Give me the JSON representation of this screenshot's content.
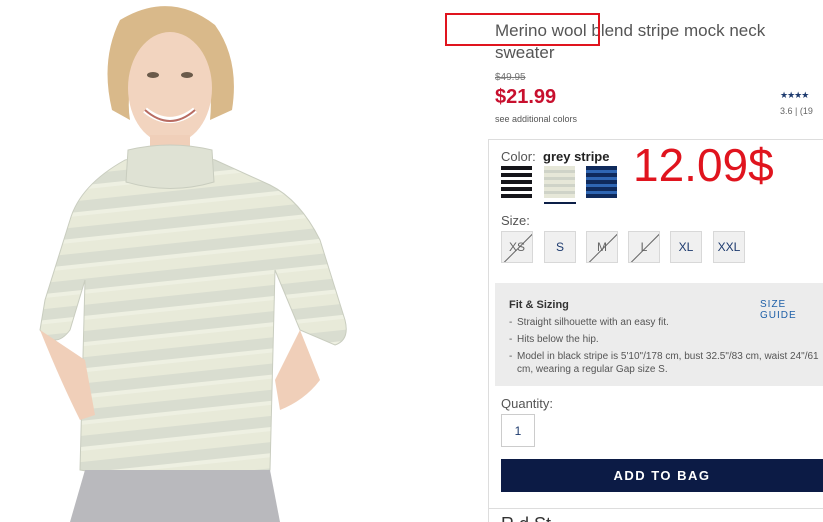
{
  "product": {
    "title": "Merino wool blend stripe mock neck sweater",
    "original_price": "$49.95",
    "sale_price": "$21.99",
    "see_colors_link": "see additional colors",
    "rating": {
      "stars": "★★★★",
      "text": "3.6 | (19"
    }
  },
  "annotation": {
    "price_note": "12.09$",
    "color": "#e0141e"
  },
  "color_picker": {
    "label": "Color:",
    "selected": "grey stripe",
    "swatches": [
      {
        "name": "black stripe",
        "colors": [
          "#15151a",
          "#ffffff"
        ]
      },
      {
        "name": "grey stripe",
        "colors": [
          "#e6e7d8",
          "#cfd3c8"
        ],
        "selected": true
      },
      {
        "name": "navy stripe",
        "colors": [
          "#0f2a5c",
          "#2f66b3"
        ]
      }
    ]
  },
  "size_picker": {
    "label": "Size:",
    "sizes": [
      {
        "label": "XS",
        "available": false
      },
      {
        "label": "S",
        "available": true
      },
      {
        "label": "M",
        "available": false
      },
      {
        "label": "L",
        "available": false
      },
      {
        "label": "XL",
        "available": true
      },
      {
        "label": "XXL",
        "available": true
      }
    ]
  },
  "fit_sizing": {
    "title": "Fit & Sizing",
    "size_guide": "SIZE GUIDE",
    "items": [
      "Straight silhouette with an easy fit.",
      "Hits below the hip.",
      "Model in black stripe is 5'10\"/178 cm, bust 32.5\"/83 cm, waist 24\"/61 cm, wearing a regular Gap size S."
    ]
  },
  "quantity": {
    "label": "Quantity:",
    "value": "1"
  },
  "cart": {
    "add_label": "ADD TO BAG"
  },
  "below_fold": {
    "heading_fragment": "R  d  St"
  },
  "colors": {
    "sale": "#c8102e",
    "button": "#0c1b45",
    "link": "#1d5fa8"
  }
}
